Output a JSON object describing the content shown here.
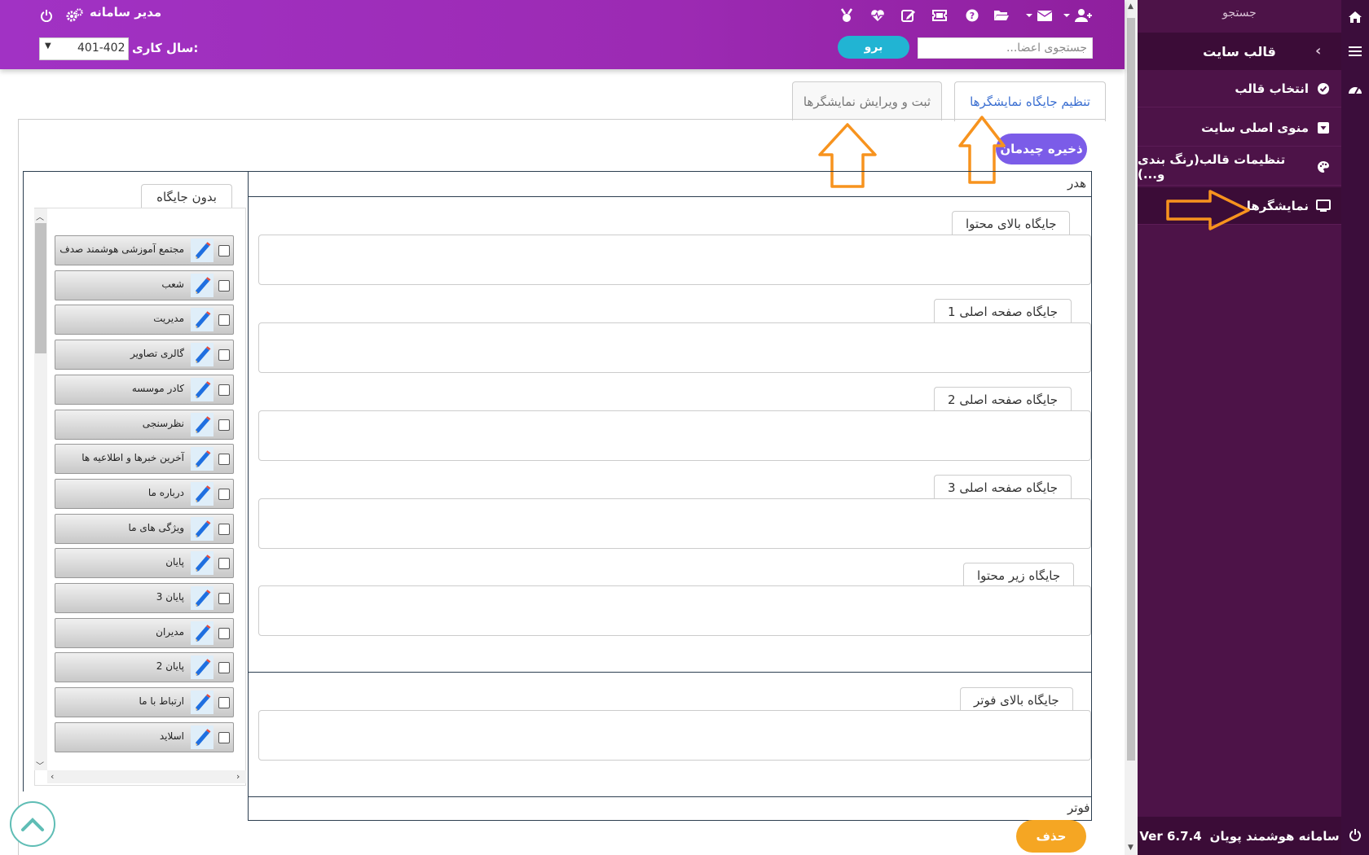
{
  "header": {
    "admin_label": "مدیر سامانه",
    "year_label": "سال کاری:",
    "year_value": "401-402",
    "search_placeholder": "جستجوی اعضا...",
    "go_label": "برو"
  },
  "sidebar": {
    "search_label": "جستجو",
    "section_title": "قالب سایت",
    "items": [
      {
        "label": "انتخاب قالب",
        "icon": "check-circle-icon"
      },
      {
        "label": "منوی اصلی سایت",
        "icon": "caret-square-icon"
      },
      {
        "label": "تنظیمات قالب(رنگ بندی و...)",
        "icon": "palette-icon"
      },
      {
        "label": "نمایشگرها",
        "icon": "monitor-icon"
      }
    ],
    "footer_name": "سامانه هوشمند پویان",
    "footer_version": "Ver 6.7.4"
  },
  "tabs": {
    "active": "تنظیم جایگاه نمایشگرها",
    "inactive": "ثبت و ویرایش نمایشگرها"
  },
  "buttons": {
    "save_layout": "ذخیره چیدمان",
    "delete": "حذف"
  },
  "layout": {
    "header_label": "هدر",
    "footer_label": "فوتر",
    "slots": [
      "جایگاه بالای محتوا",
      "جایگاه صفحه اصلی 1",
      "جایگاه صفحه اصلی 2",
      "جایگاه صفحه اصلی 3",
      "جایگاه زیر محتوا",
      "جایگاه بالای فوتر"
    ]
  },
  "unassigned": {
    "title": "بدون جایگاه",
    "items": [
      "مجتمع آموزشی هوشمند صدف",
      "شعب",
      "مدیریت",
      "گالری تصاویر",
      "کادر موسسه",
      "نظرسنجی",
      "آخرین خبرها و اطلاعیه ها",
      "درباره ما",
      "ویژگی های ما",
      "پایان",
      "پایان 3",
      "مدیران",
      "پایان 2",
      "ارتباط با ما",
      "اسلاید"
    ]
  },
  "colors": {
    "header_purple": "#9c2ab3",
    "sidebar_bg": "#4d1348",
    "accent_blue": "#3b6fd1",
    "save_purple": "#7b5ce8",
    "delete_orange": "#f5a623",
    "annotation_arrow": "#f7931e"
  }
}
